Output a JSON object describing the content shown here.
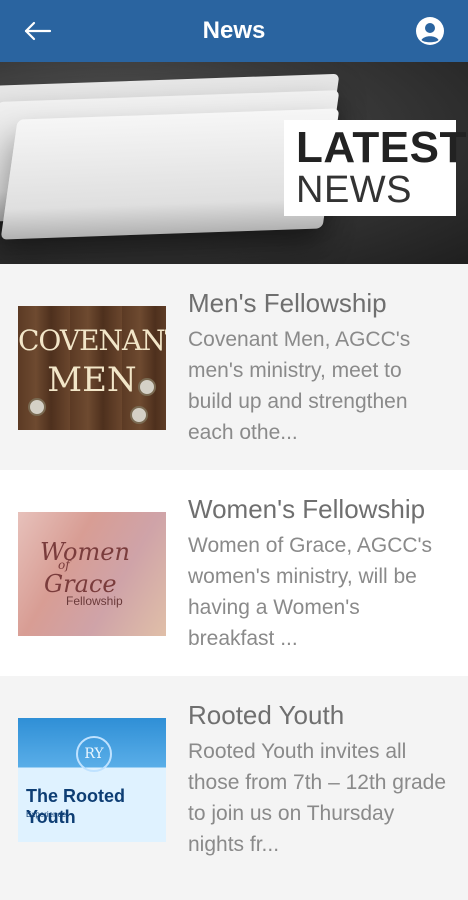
{
  "app": {
    "title": "News",
    "back_icon": "arrow-left-icon",
    "account_icon": "account-circle-icon"
  },
  "hero": {
    "banner_text_line1": "LATEST",
    "banner_text_line2": "NEWS"
  },
  "news": {
    "items": [
      {
        "title": "Men's Fellowship",
        "description": "Covenant Men, AGCC's men's ministry, meet to build up and strengthen each othe...",
        "thumbnail": {
          "line1": "COVENANT",
          "line2": "MEN"
        }
      },
      {
        "title": "Women's Fellowship",
        "description": "Women of Grace, AGCC's women's ministry, will be having a Women's breakfast ...",
        "thumbnail": {
          "line1": "Women",
          "line2": "of",
          "line3": "Grace",
          "line4": "Fellowship"
        }
      },
      {
        "title": "Rooted Youth",
        "description": "Rooted Youth invites all those from 7th – 12th grade to join us on Thursday nights fr...",
        "thumbnail": {
          "badge": "RY",
          "line1": "The Rooted Youth",
          "line2": "Experience"
        }
      }
    ]
  },
  "colors": {
    "topbar": "#2a64a0",
    "text_title": "#6f6f6f",
    "text_desc": "#8a8a8a"
  }
}
